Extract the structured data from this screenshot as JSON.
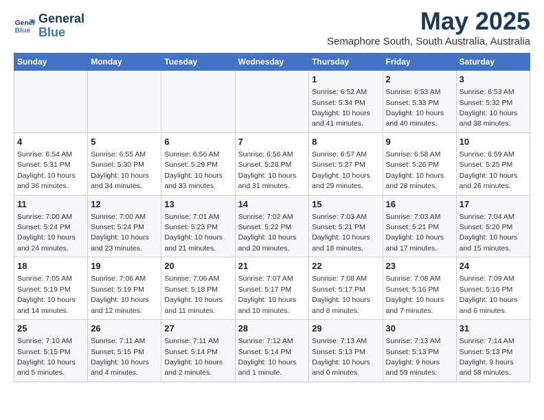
{
  "header": {
    "logo_line1": "General",
    "logo_line2": "Blue",
    "title": "May 2025",
    "subtitle": "Semaphore South, South Australia, Australia"
  },
  "days_of_week": [
    "Sunday",
    "Monday",
    "Tuesday",
    "Wednesday",
    "Thursday",
    "Friday",
    "Saturday"
  ],
  "weeks": [
    [
      {
        "day": "",
        "info": ""
      },
      {
        "day": "",
        "info": ""
      },
      {
        "day": "",
        "info": ""
      },
      {
        "day": "",
        "info": ""
      },
      {
        "day": "1",
        "info": "Sunrise: 6:52 AM\nSunset: 5:34 PM\nDaylight: 10 hours\nand 41 minutes."
      },
      {
        "day": "2",
        "info": "Sunrise: 6:53 AM\nSunset: 5:33 PM\nDaylight: 10 hours\nand 40 minutes."
      },
      {
        "day": "3",
        "info": "Sunrise: 6:53 AM\nSunset: 5:32 PM\nDaylight: 10 hours\nand 38 minutes."
      }
    ],
    [
      {
        "day": "4",
        "info": "Sunrise: 6:54 AM\nSunset: 5:31 PM\nDaylight: 10 hours\nand 36 minutes."
      },
      {
        "day": "5",
        "info": "Sunrise: 6:55 AM\nSunset: 5:30 PM\nDaylight: 10 hours\nand 34 minutes."
      },
      {
        "day": "6",
        "info": "Sunrise: 6:56 AM\nSunset: 5:29 PM\nDaylight: 10 hours\nand 33 minutes."
      },
      {
        "day": "7",
        "info": "Sunrise: 6:56 AM\nSunset: 5:28 PM\nDaylight: 10 hours\nand 31 minutes."
      },
      {
        "day": "8",
        "info": "Sunrise: 6:57 AM\nSunset: 5:27 PM\nDaylight: 10 hours\nand 29 minutes."
      },
      {
        "day": "9",
        "info": "Sunrise: 6:58 AM\nSunset: 5:26 PM\nDaylight: 10 hours\nand 28 minutes."
      },
      {
        "day": "10",
        "info": "Sunrise: 6:59 AM\nSunset: 5:25 PM\nDaylight: 10 hours\nand 26 minutes."
      }
    ],
    [
      {
        "day": "11",
        "info": "Sunrise: 7:00 AM\nSunset: 5:24 PM\nDaylight: 10 hours\nand 24 minutes."
      },
      {
        "day": "12",
        "info": "Sunrise: 7:00 AM\nSunset: 5:24 PM\nDaylight: 10 hours\nand 23 minutes."
      },
      {
        "day": "13",
        "info": "Sunrise: 7:01 AM\nSunset: 5:23 PM\nDaylight: 10 hours\nand 21 minutes."
      },
      {
        "day": "14",
        "info": "Sunrise: 7:02 AM\nSunset: 5:22 PM\nDaylight: 10 hours\nand 20 minutes."
      },
      {
        "day": "15",
        "info": "Sunrise: 7:03 AM\nSunset: 5:21 PM\nDaylight: 10 hours\nand 18 minutes."
      },
      {
        "day": "16",
        "info": "Sunrise: 7:03 AM\nSunset: 5:21 PM\nDaylight: 10 hours\nand 17 minutes."
      },
      {
        "day": "17",
        "info": "Sunrise: 7:04 AM\nSunset: 5:20 PM\nDaylight: 10 hours\nand 15 minutes."
      }
    ],
    [
      {
        "day": "18",
        "info": "Sunrise: 7:05 AM\nSunset: 5:19 PM\nDaylight: 10 hours\nand 14 minutes."
      },
      {
        "day": "19",
        "info": "Sunrise: 7:06 AM\nSunset: 5:19 PM\nDaylight: 10 hours\nand 12 minutes."
      },
      {
        "day": "20",
        "info": "Sunrise: 7:06 AM\nSunset: 5:18 PM\nDaylight: 10 hours\nand 11 minutes."
      },
      {
        "day": "21",
        "info": "Sunrise: 7:07 AM\nSunset: 5:17 PM\nDaylight: 10 hours\nand 10 minutes."
      },
      {
        "day": "22",
        "info": "Sunrise: 7:08 AM\nSunset: 5:17 PM\nDaylight: 10 hours\nand 8 minutes."
      },
      {
        "day": "23",
        "info": "Sunrise: 7:08 AM\nSunset: 5:16 PM\nDaylight: 10 hours\nand 7 minutes."
      },
      {
        "day": "24",
        "info": "Sunrise: 7:09 AM\nSunset: 5:16 PM\nDaylight: 10 hours\nand 6 minutes."
      }
    ],
    [
      {
        "day": "25",
        "info": "Sunrise: 7:10 AM\nSunset: 5:15 PM\nDaylight: 10 hours\nand 5 minutes."
      },
      {
        "day": "26",
        "info": "Sunrise: 7:11 AM\nSunset: 5:15 PM\nDaylight: 10 hours\nand 4 minutes."
      },
      {
        "day": "27",
        "info": "Sunrise: 7:11 AM\nSunset: 5:14 PM\nDaylight: 10 hours\nand 2 minutes."
      },
      {
        "day": "28",
        "info": "Sunrise: 7:12 AM\nSunset: 5:14 PM\nDaylight: 10 hours\nand 1 minute."
      },
      {
        "day": "29",
        "info": "Sunrise: 7:13 AM\nSunset: 5:13 PM\nDaylight: 10 hours\nand 0 minutes."
      },
      {
        "day": "30",
        "info": "Sunrise: 7:13 AM\nSunset: 5:13 PM\nDaylight: 9 hours\nand 59 minutes."
      },
      {
        "day": "31",
        "info": "Sunrise: 7:14 AM\nSunset: 5:13 PM\nDaylight: 9 hours\nand 58 minutes."
      }
    ]
  ]
}
